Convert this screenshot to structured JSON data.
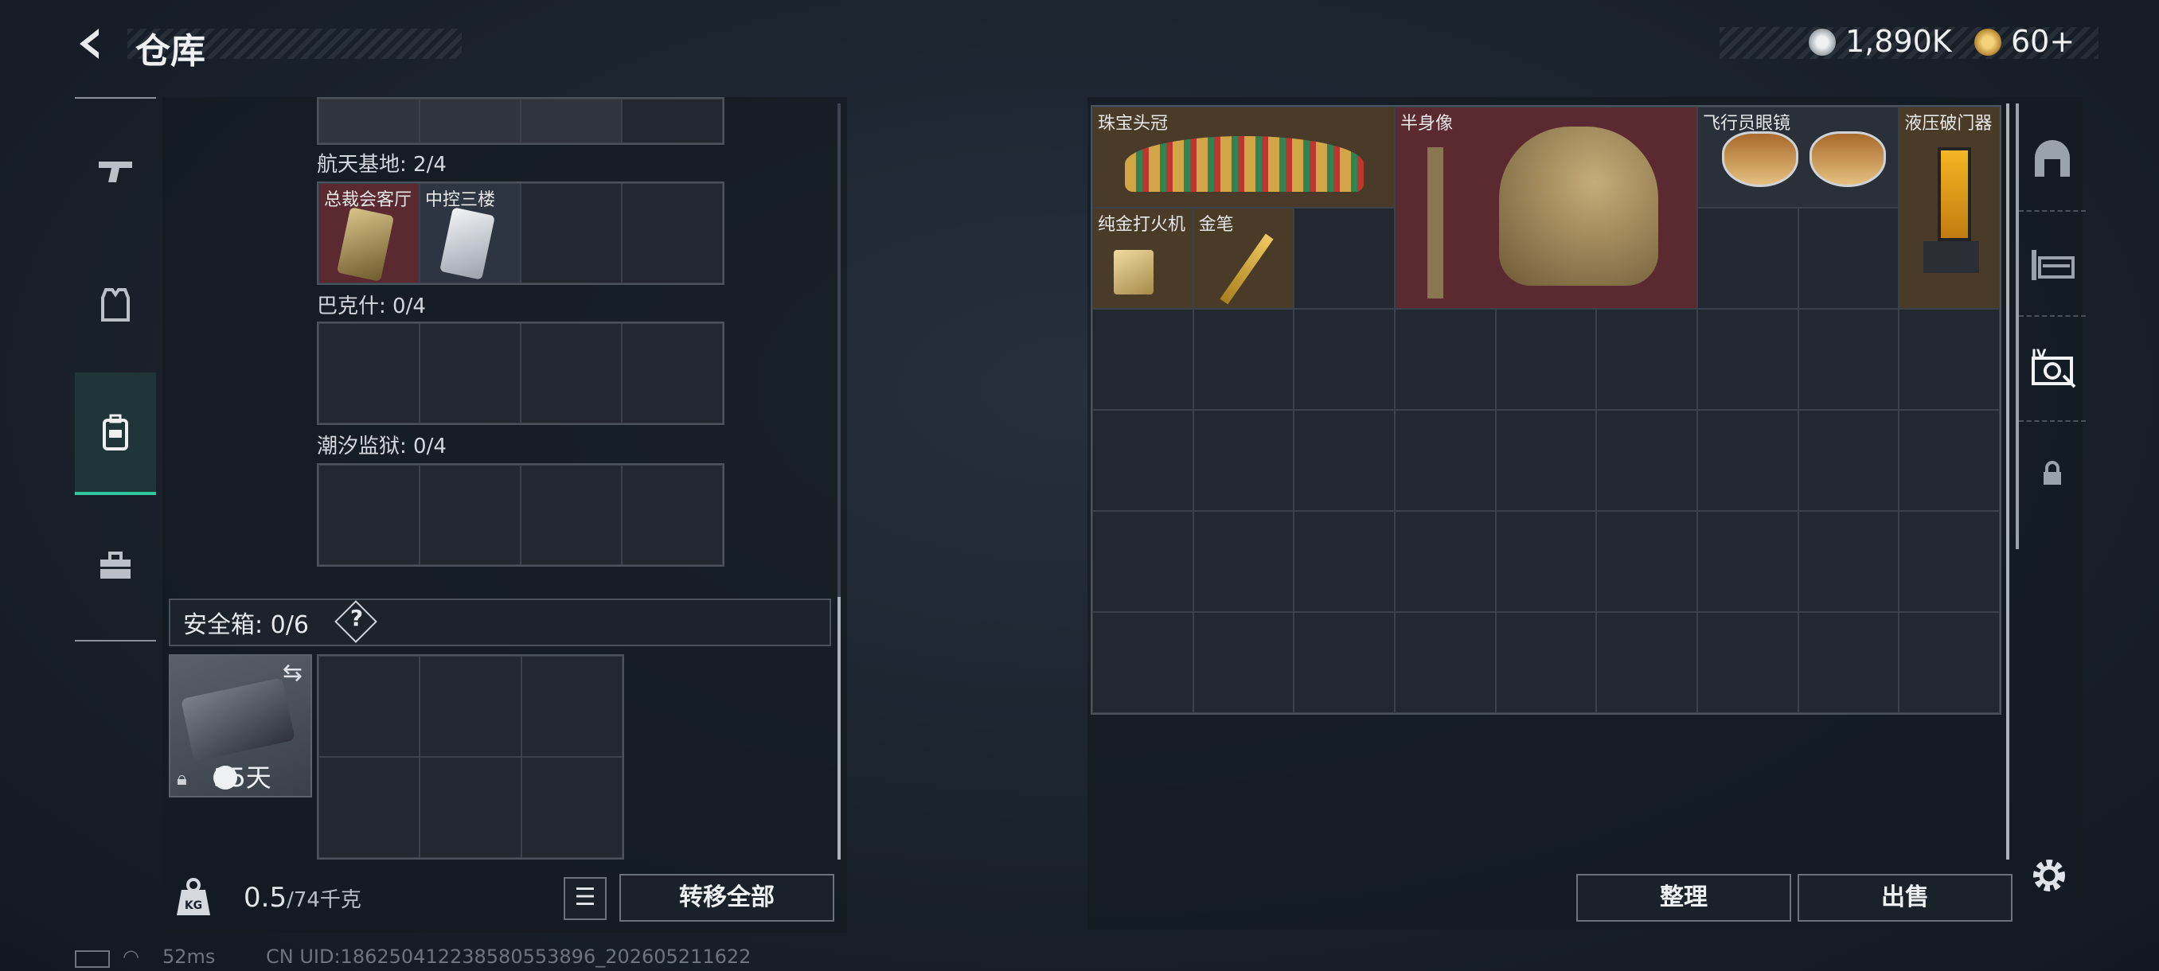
{
  "header": {
    "title": "仓库",
    "back_icon": "back-arrow-icon"
  },
  "currency": [
    {
      "icon": "silver-coin-icon",
      "value": "1,890K",
      "color": "#c9cdd1"
    },
    {
      "icon": "gold-coin-icon",
      "value": "60+",
      "color": "#d9a441"
    }
  ],
  "left_nav": [
    {
      "icon": "pistol-icon",
      "active": false
    },
    {
      "icon": "armor-vest-icon",
      "active": false
    },
    {
      "icon": "backpack-icon",
      "active": true
    },
    {
      "icon": "toolbox-icon",
      "active": false
    }
  ],
  "key_sections": [
    {
      "label": "航天基地: 2/4",
      "items": [
        "总裁会客厅",
        "中控三楼"
      ]
    },
    {
      "label": "巴克什: 0/4",
      "items": []
    },
    {
      "label": "潮汐监狱: 0/4",
      "items": []
    }
  ],
  "safe_box": {
    "label": "安全箱: 0/6",
    "help": "?",
    "days": "35天",
    "swap_icon": "swap-icon",
    "lock_icon": "lock-icon",
    "clock_icon": "clock-icon"
  },
  "weight": {
    "current": "0.5",
    "max": "/74千克",
    "icon": "weight-icon"
  },
  "buttons": {
    "list": "☰",
    "transfer_all": "转移全部",
    "sort": "整理",
    "sell": "出售"
  },
  "stash_items": [
    "珠宝头冠",
    "半身像",
    "飞行员眼镜",
    "液压破门器",
    "纯金打火机",
    "金笔"
  ],
  "right_nav": [
    {
      "icon": "stash-arch-icon",
      "active": false
    },
    {
      "icon": "shelves-icon",
      "active": false
    },
    {
      "icon": "tier4-collection-icon",
      "active": true
    },
    {
      "icon": "lock-icon",
      "active": false
    }
  ],
  "settings_icon": "gear-icon",
  "status_bar": {
    "ping": "52ms",
    "uid": "CN UID:1862504122385805538​96_202605211622"
  },
  "colors": {
    "accent": "#2fc8a0",
    "red_item_bg": "#5a2a30",
    "gold_item_bg": "#4a3a28"
  }
}
